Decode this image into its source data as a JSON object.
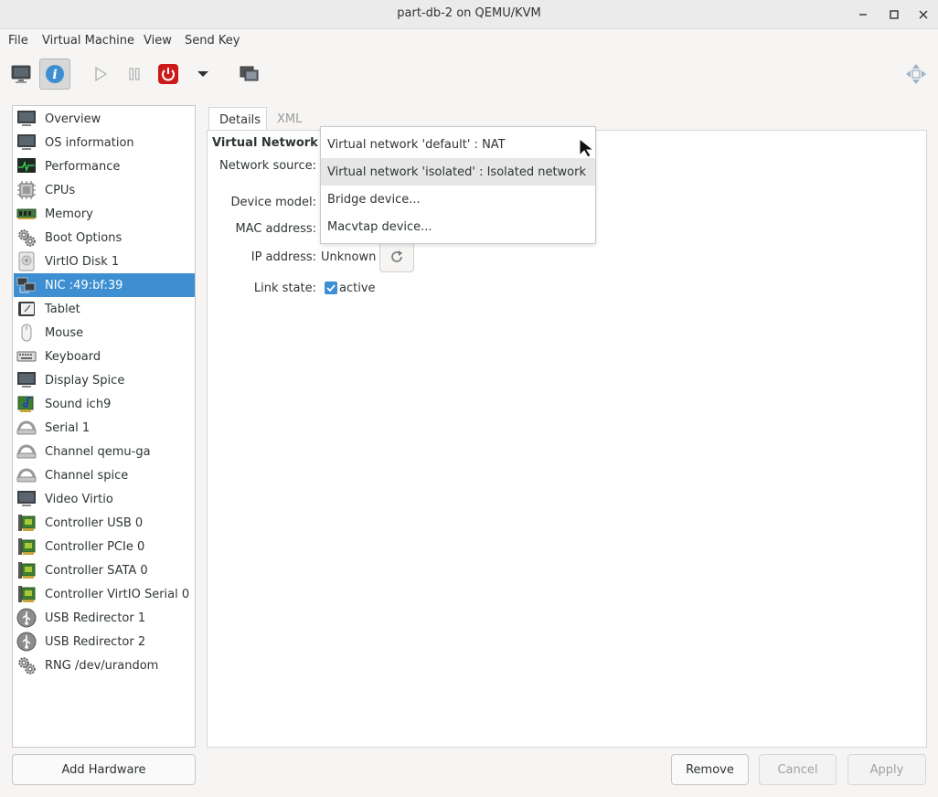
{
  "window": {
    "title": "part-db-2 on QEMU/KVM",
    "minimize": "−",
    "maximize": "☐",
    "close": "✕"
  },
  "menu": [
    "File",
    "Virtual Machine",
    "View",
    "Send Key"
  ],
  "toolbar": {
    "buttons": [
      {
        "icon": "monitor-icon",
        "active": false
      },
      {
        "icon": "info-icon",
        "active": true,
        "glyph": "i"
      },
      {
        "icon": "play-icon",
        "active": false
      },
      {
        "icon": "pause-icon",
        "active": false
      },
      {
        "icon": "power-icon",
        "active": false
      },
      {
        "icon": "dropdown-arrow-icon",
        "active": false
      },
      {
        "icon": "snapshot-icon",
        "active": false
      },
      {
        "icon": "fullscreen-icon",
        "active": false
      }
    ],
    "colors": {
      "info": "#3d8fd1",
      "power": "#cc1a1a"
    }
  },
  "sidebar": {
    "items": [
      {
        "label": "Overview",
        "icon": "monitor-icon"
      },
      {
        "label": "OS information",
        "icon": "monitor-icon"
      },
      {
        "label": "Performance",
        "icon": "performance-icon"
      },
      {
        "label": "CPUs",
        "icon": "cpu-icon"
      },
      {
        "label": "Memory",
        "icon": "memory-icon"
      },
      {
        "label": "Boot Options",
        "icon": "gears-icon"
      },
      {
        "label": "VirtIO Disk 1",
        "icon": "disk-icon"
      },
      {
        "label": "NIC :49:bf:39",
        "icon": "network-icon",
        "selected": true
      },
      {
        "label": "Tablet",
        "icon": "tablet-icon"
      },
      {
        "label": "Mouse",
        "icon": "mouse-icon"
      },
      {
        "label": "Keyboard",
        "icon": "keyboard-icon"
      },
      {
        "label": "Display Spice",
        "icon": "monitor-icon"
      },
      {
        "label": "Sound ich9",
        "icon": "sound-card-icon"
      },
      {
        "label": "Serial 1",
        "icon": "serial-icon"
      },
      {
        "label": "Channel qemu-ga",
        "icon": "serial-icon"
      },
      {
        "label": "Channel spice",
        "icon": "serial-icon"
      },
      {
        "label": "Video Virtio",
        "icon": "monitor-icon"
      },
      {
        "label": "Controller USB 0",
        "icon": "controller-card-icon"
      },
      {
        "label": "Controller PCIe 0",
        "icon": "controller-card-icon"
      },
      {
        "label": "Controller SATA 0",
        "icon": "controller-card-icon"
      },
      {
        "label": "Controller VirtIO Serial 0",
        "icon": "controller-card-icon"
      },
      {
        "label": "USB Redirector 1",
        "icon": "usb-icon"
      },
      {
        "label": "USB Redirector 2",
        "icon": "usb-icon"
      },
      {
        "label": "RNG /dev/urandom",
        "icon": "gears-icon"
      }
    ],
    "selected_color": "#3d8fd1"
  },
  "tabs": [
    {
      "label": "Details",
      "active": true
    },
    {
      "label": "XML",
      "active": false
    }
  ],
  "details": {
    "section_title": "Virtual Network Interface",
    "network_source_label": "Network source:",
    "device_model_label": "Device model:",
    "mac_address_label": "MAC address:",
    "ip_address_label": "IP address:",
    "ip_address_value": "Unknown",
    "link_state_label": "Link state:",
    "link_state_value": "active",
    "link_state_checked": true
  },
  "network_source_dropdown": {
    "options": [
      "Virtual network 'default' : NAT",
      "Virtual network 'isolated' : Isolated network",
      "Bridge device...",
      "Macvtap device..."
    ],
    "highlighted": 1
  },
  "footer": {
    "add_hardware": "Add Hardware",
    "remove": "Remove",
    "cancel": "Cancel",
    "apply": "Apply"
  }
}
